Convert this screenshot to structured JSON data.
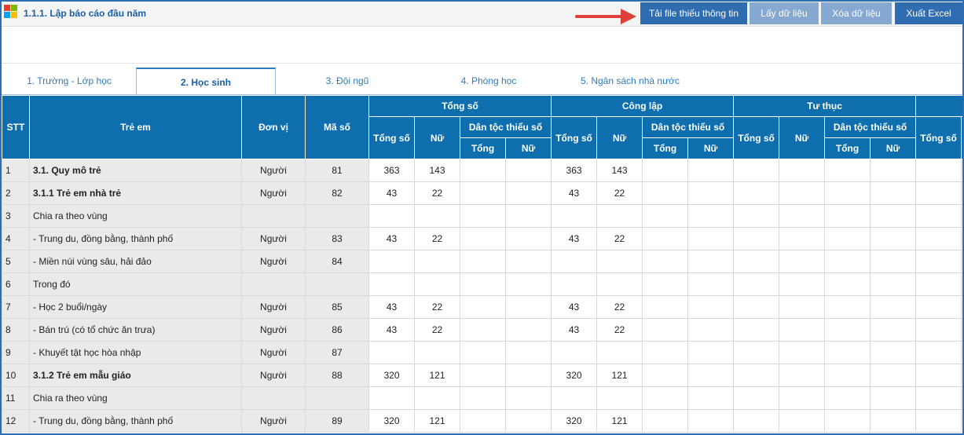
{
  "window": {
    "title": "1.1.1. Lập báo cáo đầu năm"
  },
  "toolbar": {
    "upload_missing_label": "Tải file thiếu thông tin",
    "fetch_data_label": "Lấy dữ liệu",
    "delete_data_label": "Xóa dữ liệu",
    "export_excel_label": "Xuất Excel",
    "arrow_color": "#e0403a"
  },
  "tabs": [
    {
      "label": "1. Trường - Lớp học",
      "active": false
    },
    {
      "label": "2. Học sinh",
      "active": true
    },
    {
      "label": "3. Đội ngũ",
      "active": false
    },
    {
      "label": "4. Phòng học",
      "active": false
    },
    {
      "label": "5. Ngân sách nhà nước",
      "active": false
    }
  ],
  "table": {
    "headers": {
      "stt": "STT",
      "tre_em": "Trẻ em",
      "don_vi": "Đơn vị",
      "ma_so": "Mã số",
      "tong_so_group": "Tổng số",
      "cong_lap_group": "Công lập",
      "tu_thuc_group": "Tư thục",
      "tong_so": "Tổng số",
      "nu": "Nữ",
      "dan_toc": "Dân tộc thiểu số",
      "tong": "Tổng",
      "dt_nu": "Nữ"
    },
    "rows": [
      {
        "stt": "1",
        "name": "3.1. Quy mô trẻ",
        "bold": true,
        "unit": "Người",
        "code": "81",
        "ts_tong": "363",
        "ts_nu": "143",
        "cl_tong": "363",
        "cl_nu": "143"
      },
      {
        "stt": "2",
        "name": "3.1.1 Trẻ em nhà trẻ",
        "bold": true,
        "unit": "Người",
        "code": "82",
        "ts_tong": "43",
        "ts_nu": "22",
        "cl_tong": "43",
        "cl_nu": "22"
      },
      {
        "stt": "3",
        "name": "Chia ra theo vùng",
        "bold": false,
        "unit": "",
        "code": "",
        "ts_tong": "",
        "ts_nu": "",
        "cl_tong": "",
        "cl_nu": ""
      },
      {
        "stt": "4",
        "name": "- Trung du, đồng bằng, thành phố",
        "bold": false,
        "unit": "Người",
        "code": "83",
        "ts_tong": "43",
        "ts_nu": "22",
        "cl_tong": "43",
        "cl_nu": "22"
      },
      {
        "stt": "5",
        "name": "- Miền núi vùng sâu, hải đảo",
        "bold": false,
        "unit": "Người",
        "code": "84",
        "ts_tong": "",
        "ts_nu": "",
        "cl_tong": "",
        "cl_nu": ""
      },
      {
        "stt": "6",
        "name": "Trong đó",
        "bold": false,
        "unit": "",
        "code": "",
        "ts_tong": "",
        "ts_nu": "",
        "cl_tong": "",
        "cl_nu": ""
      },
      {
        "stt": "7",
        "name": "- Học 2 buổi/ngày",
        "bold": false,
        "unit": "Người",
        "code": "85",
        "ts_tong": "43",
        "ts_nu": "22",
        "cl_tong": "43",
        "cl_nu": "22"
      },
      {
        "stt": "8",
        "name": "- Bán trú (có tổ chức ăn trưa)",
        "bold": false,
        "unit": "Người",
        "code": "86",
        "ts_tong": "43",
        "ts_nu": "22",
        "cl_tong": "43",
        "cl_nu": "22"
      },
      {
        "stt": "9",
        "name": "- Khuyết tật học hòa nhập",
        "bold": false,
        "unit": "Người",
        "code": "87",
        "ts_tong": "",
        "ts_nu": "",
        "cl_tong": "",
        "cl_nu": ""
      },
      {
        "stt": "10",
        "name": "3.1.2 Trẻ em mẫu giáo",
        "bold": true,
        "unit": "Người",
        "code": "88",
        "ts_tong": "320",
        "ts_nu": "121",
        "cl_tong": "320",
        "cl_nu": "121"
      },
      {
        "stt": "11",
        "name": "Chia ra theo vùng",
        "bold": false,
        "unit": "",
        "code": "",
        "ts_tong": "",
        "ts_nu": "",
        "cl_tong": "",
        "cl_nu": ""
      },
      {
        "stt": "12",
        "name": "- Trung du, đồng bằng, thành phố",
        "bold": false,
        "unit": "Người",
        "code": "89",
        "ts_tong": "320",
        "ts_nu": "121",
        "cl_tong": "320",
        "cl_nu": "121"
      }
    ]
  }
}
